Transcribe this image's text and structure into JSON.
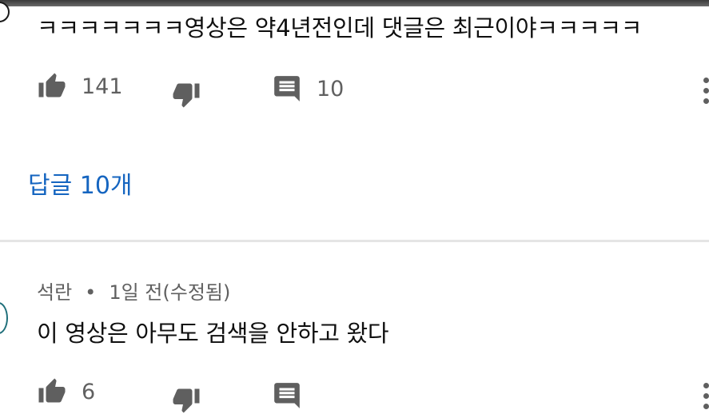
{
  "comments": [
    {
      "author": "",
      "text": "ㅋㅋㅋㅋㅋㅋㅋ영상은 약4년전인데 댓글은 최근이야ㅋㅋㅋㅋㅋ",
      "likes": "141",
      "reply_count": "10",
      "replies_link": "답글 10개"
    },
    {
      "author": "석란",
      "separator": "•",
      "time": "1일 전(수정됨)",
      "text": "이 영상은 아무도 검색을 안하고 왔다",
      "likes": "6"
    }
  ],
  "icons": {
    "like": "thumbs-up-icon",
    "dislike": "thumbs-down-icon",
    "reply": "comment-icon",
    "more": "more-vert-icon"
  },
  "colors": {
    "icon": "#5f5f5f",
    "link": "#1565c0",
    "text": "#0f0f0f",
    "meta": "#606060"
  }
}
